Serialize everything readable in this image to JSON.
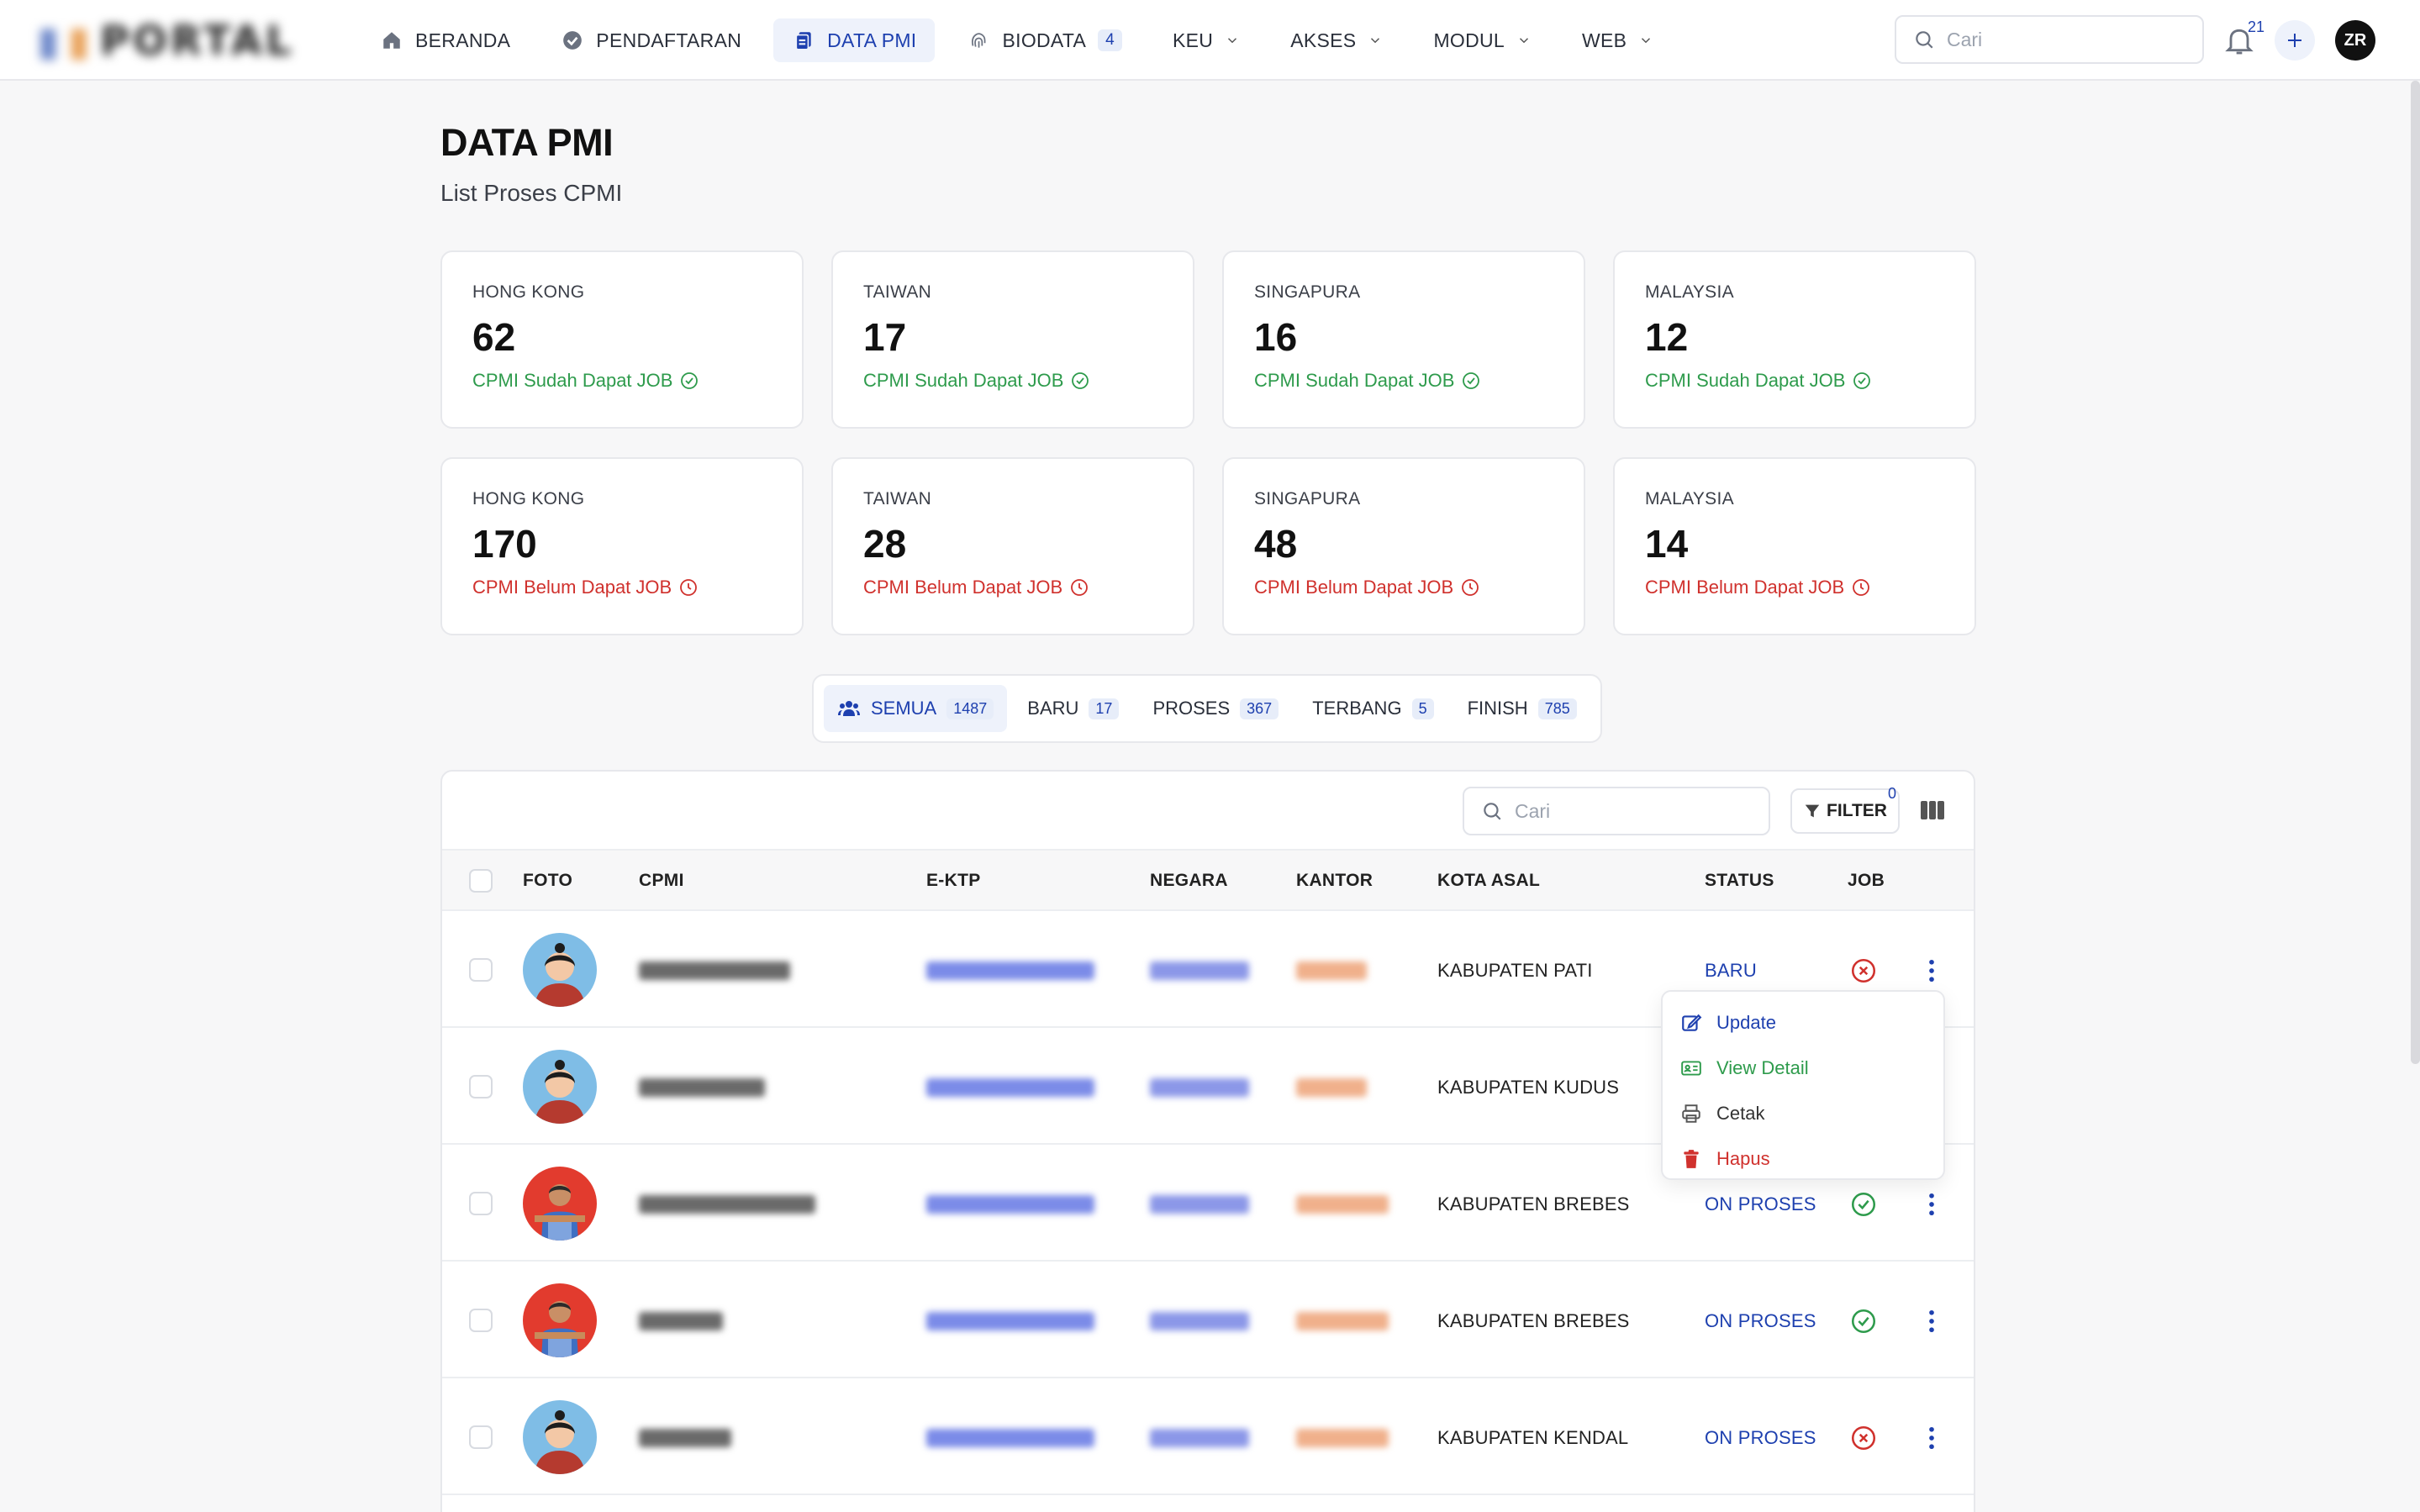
{
  "brand": {
    "name": "PORTAL"
  },
  "nav": {
    "items": [
      {
        "label": "BERANDA"
      },
      {
        "label": "PENDAFTARAN"
      },
      {
        "label": "DATA PMI"
      },
      {
        "label": "BIODATA",
        "badge": "4"
      },
      {
        "label": "KEU"
      },
      {
        "label": "AKSES"
      },
      {
        "label": "MODUL"
      },
      {
        "label": "WEB"
      }
    ]
  },
  "topbar": {
    "search_placeholder": "Cari",
    "notification_count": "21",
    "user_initials": "ZR"
  },
  "page": {
    "title": "DATA PMI",
    "subtitle": "List Proses CPMI"
  },
  "cards": [
    {
      "country": "HONG KONG",
      "count": "62",
      "desc": "CPMI Sudah Dapat JOB"
    },
    {
      "country": "TAIWAN",
      "count": "17",
      "desc": "CPMI Sudah Dapat JOB"
    },
    {
      "country": "SINGAPURA",
      "count": "16",
      "desc": "CPMI Sudah Dapat JOB"
    },
    {
      "country": "MALAYSIA",
      "count": "12",
      "desc": "CPMI Sudah Dapat JOB"
    },
    {
      "country": "HONG KONG",
      "count": "170",
      "desc": "CPMI Belum Dapat JOB"
    },
    {
      "country": "TAIWAN",
      "count": "28",
      "desc": "CPMI Belum Dapat JOB"
    },
    {
      "country": "SINGAPURA",
      "count": "48",
      "desc": "CPMI Belum Dapat JOB"
    },
    {
      "country": "MALAYSIA",
      "count": "14",
      "desc": "CPMI Belum Dapat JOB"
    }
  ],
  "tabs": [
    {
      "label": "SEMUA",
      "count": "1487"
    },
    {
      "label": "BARU",
      "count": "17"
    },
    {
      "label": "PROSES",
      "count": "367"
    },
    {
      "label": "TERBANG",
      "count": "5"
    },
    {
      "label": "FINISH",
      "count": "785"
    }
  ],
  "table": {
    "search_placeholder": "Cari",
    "filter_label": "FILTER",
    "filter_count": "0",
    "columns": [
      "FOTO",
      "CPMI",
      "E-KTP",
      "NEGARA",
      "KANTOR",
      "KOTA ASAL",
      "STATUS",
      "JOB"
    ],
    "rows": [
      {
        "kota": "KABUPATEN PATI",
        "status": "BARU",
        "job": "no"
      },
      {
        "kota": "KABUPATEN KUDUS",
        "status": "",
        "job": "none"
      },
      {
        "kota": "KABUPATEN BREBES",
        "status": "ON PROSES",
        "job": "yes"
      },
      {
        "kota": "KABUPATEN BREBES",
        "status": "ON PROSES",
        "job": "yes"
      },
      {
        "kota": "KABUPATEN KENDAL",
        "status": "ON PROSES",
        "job": "no"
      }
    ]
  },
  "row_menu": {
    "update": "Update",
    "view": "View Detail",
    "cetak": "Cetak",
    "hapus": "Hapus"
  },
  "colors": {
    "accent": "#1e40af",
    "success": "#2e9b4c",
    "danger": "#d0312d"
  }
}
